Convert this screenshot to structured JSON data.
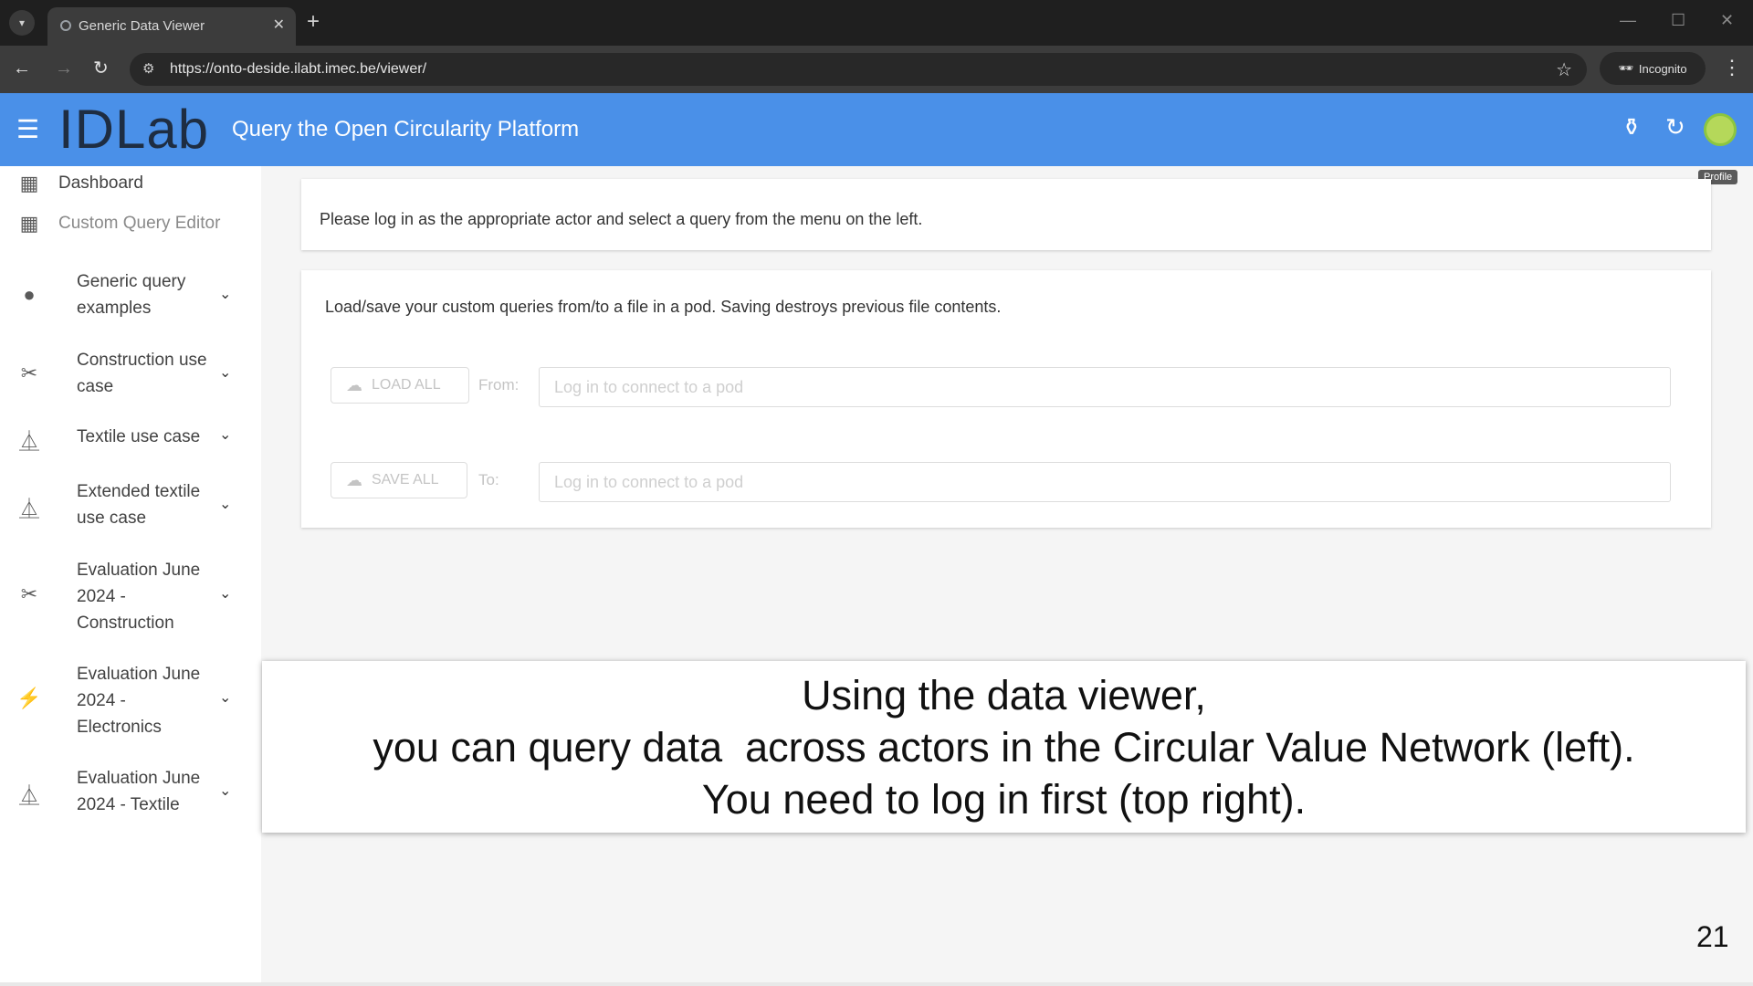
{
  "browser": {
    "tab_title": "Generic Data Viewer",
    "url": "https://onto-deside.ilabt.imec.be/viewer/",
    "incognito_label": "Incognito",
    "icons": [
      "tab-search-icon",
      "globe-icon",
      "close-icon",
      "plus-icon",
      "back-icon",
      "forward-icon",
      "reload-icon",
      "site-settings-icon",
      "star-icon",
      "incognito-icon",
      "kebab-menu-icon"
    ]
  },
  "header": {
    "logo": "IDLab",
    "title": "Query the Open Circularity Platform",
    "profile_tooltip": "Profile",
    "accent_color": "#4a90e8"
  },
  "sidebar": {
    "items": [
      {
        "label": "Dashboard",
        "icon": "dashboard-icon"
      },
      {
        "label": "Custom Query Editor",
        "icon": "grid-icon"
      },
      {
        "label": "Generic query examples",
        "icon": "info-icon"
      },
      {
        "label": "Construction use case",
        "icon": "tools-icon"
      },
      {
        "label": "Textile use case",
        "icon": "hanger-icon"
      },
      {
        "label": "Extended textile use case",
        "icon": "hanger-icon"
      },
      {
        "label": "Evaluation June 2024 - Construction",
        "icon": "tools-icon"
      },
      {
        "label": "Evaluation June 2024 - Electronics",
        "icon": "bolt-icon"
      },
      {
        "label": "Evaluation June 2024 - Textile",
        "icon": "hanger-icon"
      }
    ]
  },
  "main": {
    "intro": "Please log in as the appropriate actor and select a query from the menu on the left.",
    "pod_help": "Load/save your custom queries from/to a file in a pod. Saving destroys previous file contents.",
    "load_button": "LOAD ALL",
    "from_label": "From:",
    "save_button": "SAVE ALL",
    "to_label": "To:",
    "pod_placeholder": "Log in to connect to a pod"
  },
  "caption": {
    "line1": "Using the data viewer,",
    "line2": "you can query data  across actors in the Circular Value Network (left).",
    "line3": "You need to log in first (top right)."
  },
  "slide_number": "21"
}
